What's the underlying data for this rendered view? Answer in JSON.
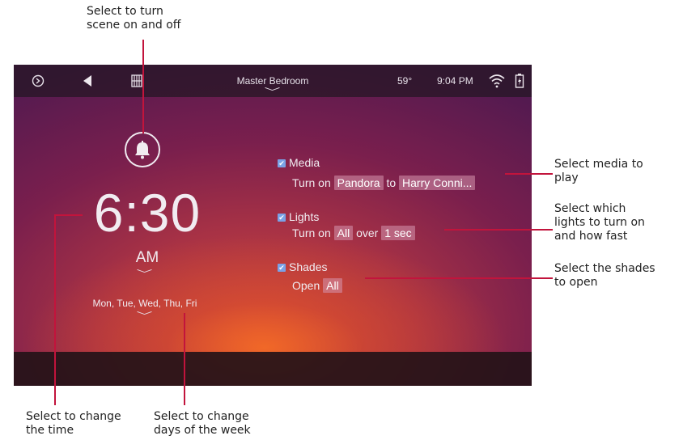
{
  "callouts": {
    "scene_toggle": [
      "Select to turn",
      "scene on and off"
    ],
    "media": [
      "Select media to",
      "play"
    ],
    "lights": [
      "Select which",
      "lights to turn on",
      "and how fast"
    ],
    "shades": [
      "Select the shades",
      "to open"
    ],
    "time": [
      "Select to change",
      "the time"
    ],
    "days": [
      "Select to change",
      "days of the week"
    ]
  },
  "status_bar": {
    "room": "Master Bedroom",
    "temperature": "59°",
    "clock": "9:04 PM"
  },
  "alarm": {
    "time": "6:30",
    "ampm": "AM",
    "days": "Mon, Tue, Wed, Thu, Fri"
  },
  "media": {
    "label": "Media",
    "checked": true,
    "prefix": "Turn on",
    "source": "Pandora",
    "joiner": "to",
    "station": "Harry Conni..."
  },
  "lights": {
    "label": "Lights",
    "checked": true,
    "prefix": "Turn on",
    "which": "All",
    "joiner": "over",
    "duration": "1 sec"
  },
  "shades": {
    "label": "Shades",
    "checked": true,
    "prefix": "Open",
    "which": "All"
  },
  "icons": [
    "logo-icon",
    "back-arrow-icon",
    "room-grid-icon",
    "wifi-icon",
    "battery-icon",
    "bell-icon",
    "chevron-down-icon"
  ],
  "colors": {
    "accent_line": "#c2143c",
    "checkbox": "#7aa2e6",
    "chip": "#d696af"
  }
}
